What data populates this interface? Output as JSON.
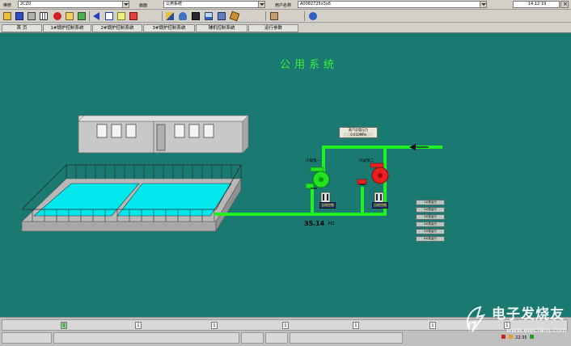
{
  "top_bar": {
    "field1_label": "维修",
    "field1_value": "2CZ0",
    "field2_label": "画面",
    "field2_value": "公用系统",
    "field3_label": "用户名称",
    "field3_value": "A0082725x3x6",
    "clock": "14:12:19"
  },
  "toolbar_icons": [
    "open-icon",
    "save-icon",
    "print-icon",
    "grid-icon",
    "alarm-icon",
    "folder-icon",
    "check-icon",
    "back-icon",
    "window-icon",
    "note-icon",
    "stop-icon",
    "trend-icon",
    "user-icon",
    "report-icon",
    "chart-icon",
    "monitor-icon",
    "pen-icon",
    "doc-icon",
    "export-icon",
    "help-icon"
  ],
  "nav_tabs": [
    {
      "label": "首  页"
    },
    {
      "label": "1#锅炉控制系统"
    },
    {
      "label": "2#锅炉控制系统"
    },
    {
      "label": "3#锅炉控制系统"
    },
    {
      "label": "辅机控制系统"
    },
    {
      "label": "运行参数"
    }
  ],
  "page_title": "公用系统",
  "pressure_box": {
    "label": "蒸汽总管压力",
    "value": "0.010MPa"
  },
  "pump1": {
    "label": "冷却泵一",
    "status_label": "当地控制",
    "color": "#22e022"
  },
  "pump2": {
    "label": "冷却泵二",
    "status_label": "当地控制",
    "color": "#e82020"
  },
  "flow_reading": {
    "value": "35.14",
    "unit": "Hz"
  },
  "right_buttons": [
    "1#泵运行",
    "2#泵运行",
    "3#泵运行",
    "4#泵运行",
    "5#泵运行",
    "6#泵运行"
  ],
  "bottom_info_icons": [
    "i",
    "i",
    "i",
    "i",
    "i",
    "i",
    "i"
  ],
  "watermark": {
    "title": "电子发烧友",
    "url": "www.elecfans.com"
  },
  "tray_time": "22:35"
}
